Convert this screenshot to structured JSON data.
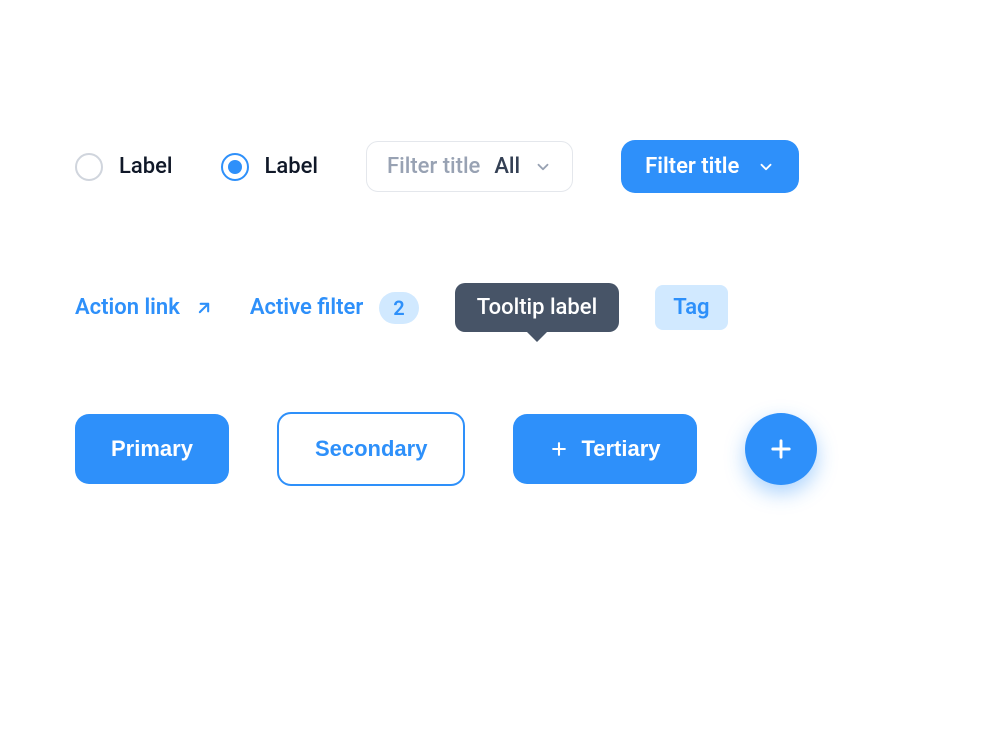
{
  "radios": {
    "unselected": {
      "label": "Label"
    },
    "selected": {
      "label": "Label"
    }
  },
  "filters": {
    "light": {
      "title": "Filter title",
      "value": "All"
    },
    "solid": {
      "title": "Filter title"
    }
  },
  "action_link": {
    "label": "Action link"
  },
  "active_filter": {
    "label": "Active filter",
    "count": "2"
  },
  "tooltip": {
    "label": "Tooltip label"
  },
  "tag": {
    "label": "Tag"
  },
  "buttons": {
    "primary": "Primary",
    "secondary": "Secondary",
    "tertiary": "Tertiary"
  },
  "colors": {
    "accent": "#2e90fa",
    "accent_light": "#d1e9ff",
    "tooltip_bg": "#475467",
    "text": "#101828",
    "muted": "#98a2b3",
    "border": "#e4e7ec"
  }
}
